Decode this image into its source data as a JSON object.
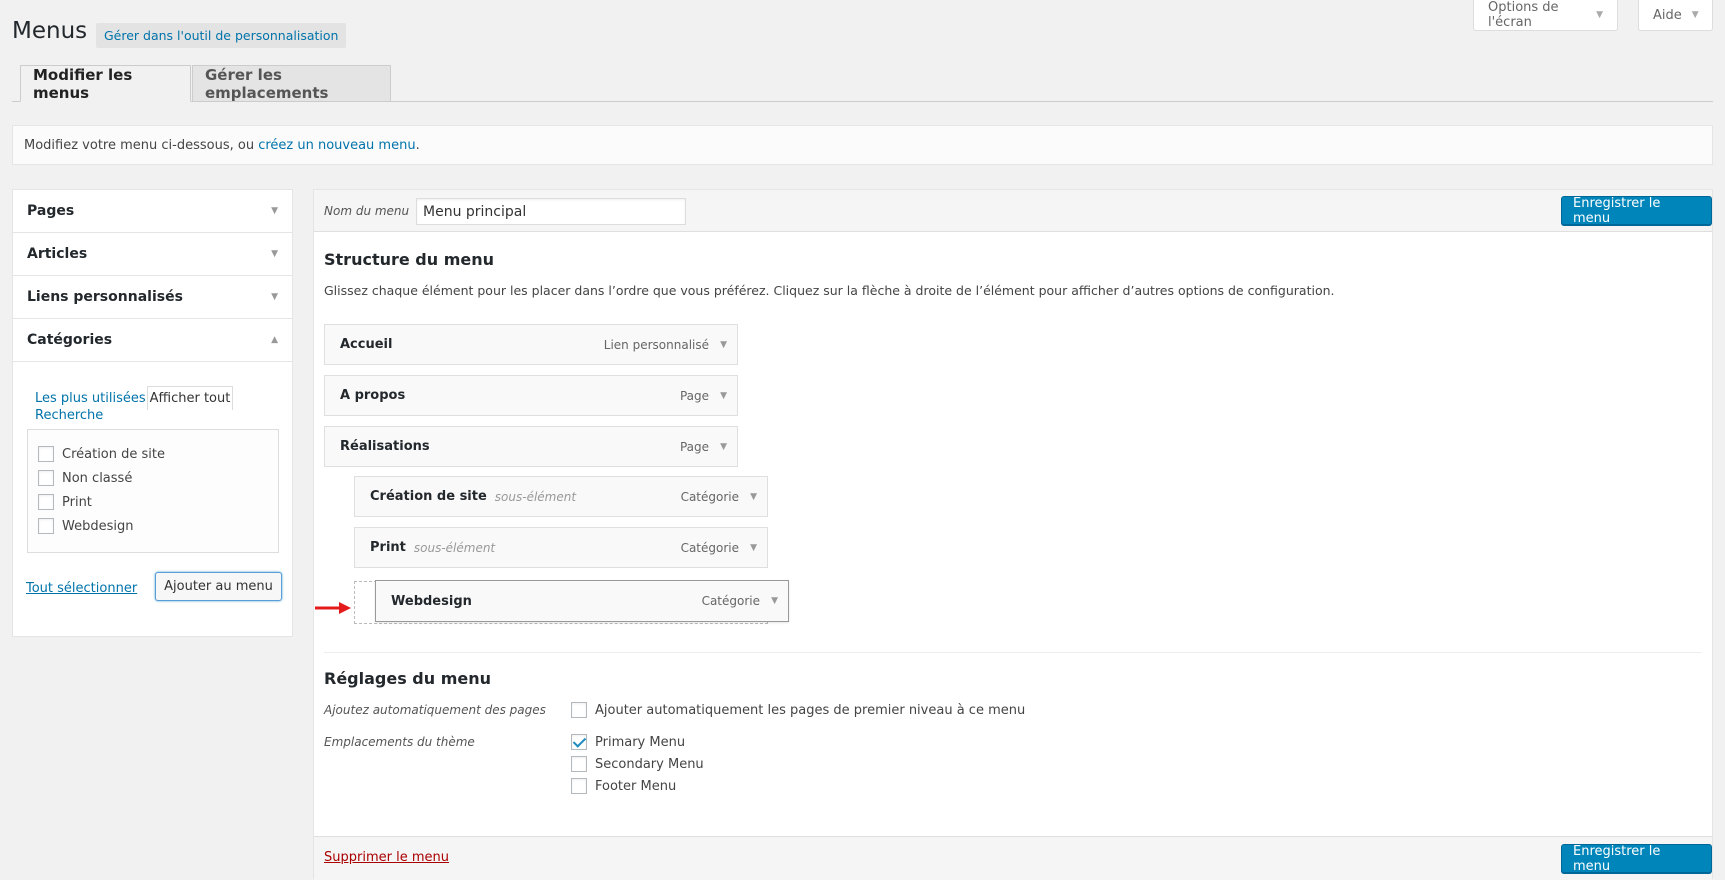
{
  "screen_meta": {
    "screen_options": "Options de l'écran",
    "help": "Aide"
  },
  "header": {
    "title": "Menus",
    "action": "Gérer dans l'outil de personnalisation"
  },
  "tabs": [
    {
      "label": "Modifier les menus",
      "active": true
    },
    {
      "label": "Gérer les emplacements",
      "active": false
    }
  ],
  "manage": {
    "prefix": "Modifiez votre menu ci-dessous, ou ",
    "link": "créez un nouveau menu",
    "suffix": "."
  },
  "sidebar": {
    "sections": [
      {
        "label": "Pages",
        "expanded": false
      },
      {
        "label": "Articles",
        "expanded": false
      },
      {
        "label": "Liens personnalisés",
        "expanded": false
      },
      {
        "label": "Catégories",
        "expanded": true
      }
    ],
    "categories": {
      "tabs": {
        "most_used": "Les plus utilisées",
        "show_all": "Afficher tout",
        "search": "Recherche"
      },
      "items": [
        {
          "label": "Création de site",
          "checked": false
        },
        {
          "label": "Non classé",
          "checked": false
        },
        {
          "label": "Print",
          "checked": false
        },
        {
          "label": "Webdesign",
          "checked": false
        }
      ],
      "select_all": "Tout sélectionner",
      "add_button": "Ajouter au menu"
    }
  },
  "menu": {
    "name_label": "Nom du menu",
    "name_value": "Menu principal",
    "save_label": "Enregistrer le menu",
    "structure_title": "Structure du menu",
    "structure_hint": "Glissez chaque élément pour les placer dans l’ordre que vous préférez. Cliquez sur la flèche à droite de l’élément pour afficher d’autres options de configuration.",
    "items": [
      {
        "title": "Accueil",
        "sub": "",
        "type": "Lien personnalisé",
        "depth": 0
      },
      {
        "title": "A propos",
        "sub": "",
        "type": "Page",
        "depth": 0
      },
      {
        "title": "Réalisations",
        "sub": "",
        "type": "Page",
        "depth": 0
      },
      {
        "title": "Création de site",
        "sub": "sous-élément",
        "type": "Catégorie",
        "depth": 1
      },
      {
        "title": "Print",
        "sub": "sous-élément",
        "type": "Catégorie",
        "depth": 1
      }
    ],
    "dragging_item": {
      "title": "Webdesign",
      "type": "Catégorie"
    },
    "settings_title": "Réglages du menu",
    "auto_add_label": "Ajoutez automatiquement des pages",
    "auto_add_option": {
      "label": "Ajouter automatiquement les pages de premier niveau à ce menu",
      "checked": false
    },
    "locations_label": "Emplacements du thème",
    "locations": [
      {
        "label": "Primary Menu",
        "checked": true
      },
      {
        "label": "Secondary Menu",
        "checked": false
      },
      {
        "label": "Footer Menu",
        "checked": false
      }
    ],
    "delete_label": "Supprimer le menu"
  },
  "colors": {
    "primary_button": "#0085ba",
    "link": "#0073aa",
    "delete_link": "#a00000",
    "arrow": "#e31b1b"
  }
}
